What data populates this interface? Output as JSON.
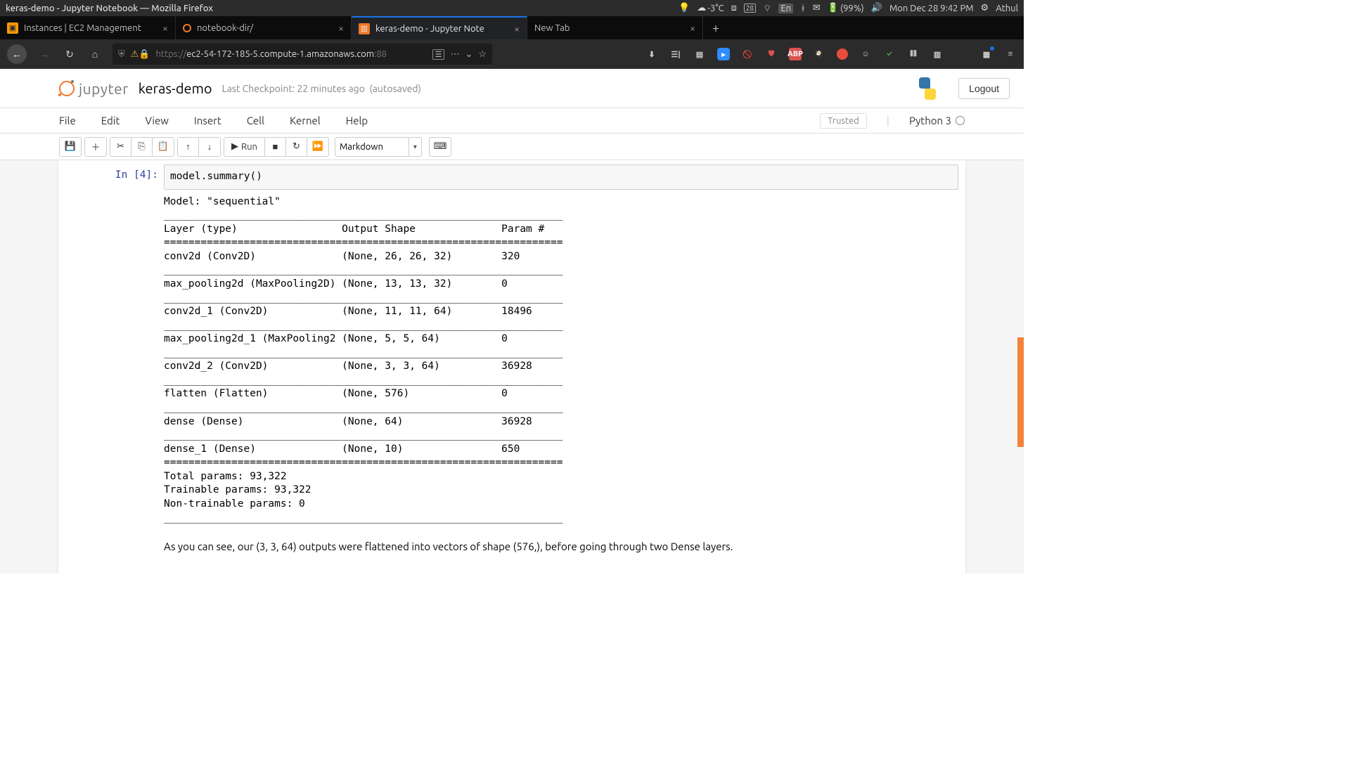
{
  "os": {
    "window_title": "keras-demo - Jupyter Notebook — Mozilla Firefox",
    "temp": "-3°C",
    "date_badge": "28",
    "lang": "En",
    "battery": "(99%)",
    "datetime": "Mon Dec 28  9:42 PM",
    "user": "Athul"
  },
  "tabs": [
    {
      "label": "Instances | EC2 Management",
      "favicon_bg": "#ff9900",
      "favicon_txt": "⬛"
    },
    {
      "label": "notebook-dir/",
      "favicon_bg": "#000",
      "favicon_txt": "◯"
    },
    {
      "label": "keras-demo - Jupyter Note",
      "favicon_bg": "#f37626",
      "favicon_txt": "📙",
      "active": true
    },
    {
      "label": "New Tab",
      "favicon_bg": "transparent",
      "favicon_txt": ""
    }
  ],
  "url": {
    "scheme": "https://",
    "host": "ec2-54-172-185-5.compute-1.amazonaws.com",
    "port": ":88"
  },
  "jupyter": {
    "logo_text": "jupyter",
    "nb_name": "keras-demo",
    "checkpoint": "Last Checkpoint: 22 minutes ago",
    "autosave": "(autosaved)",
    "logout": "Logout",
    "trusted": "Trusted",
    "kernel": "Python 3",
    "menus": [
      "File",
      "Edit",
      "View",
      "Insert",
      "Cell",
      "Kernel",
      "Help"
    ],
    "run_label": "Run",
    "cell_type": "Markdown"
  },
  "cell": {
    "prompt": "In [4]:",
    "code": "model.summary()",
    "output": "Model: \"sequential\"\n_________________________________________________________________\nLayer (type)                 Output Shape              Param #   \n=================================================================\nconv2d (Conv2D)              (None, 26, 26, 32)        320       \n_________________________________________________________________\nmax_pooling2d (MaxPooling2D) (None, 13, 13, 32)        0         \n_________________________________________________________________\nconv2d_1 (Conv2D)            (None, 11, 11, 64)        18496     \n_________________________________________________________________\nmax_pooling2d_1 (MaxPooling2 (None, 5, 5, 64)          0         \n_________________________________________________________________\nconv2d_2 (Conv2D)            (None, 3, 3, 64)          36928     \n_________________________________________________________________\nflatten (Flatten)            (None, 576)               0         \n_________________________________________________________________\ndense (Dense)                (None, 64)                36928     \n_________________________________________________________________\ndense_1 (Dense)              (None, 10)                650       \n=================================================================\nTotal params: 93,322\nTrainable params: 93,322\nNon-trainable params: 0\n_________________________________________________________________"
  },
  "md_text": "As you can see, our (3, 3, 64) outputs were flattened into vectors of shape (576,), before going through two Dense layers."
}
